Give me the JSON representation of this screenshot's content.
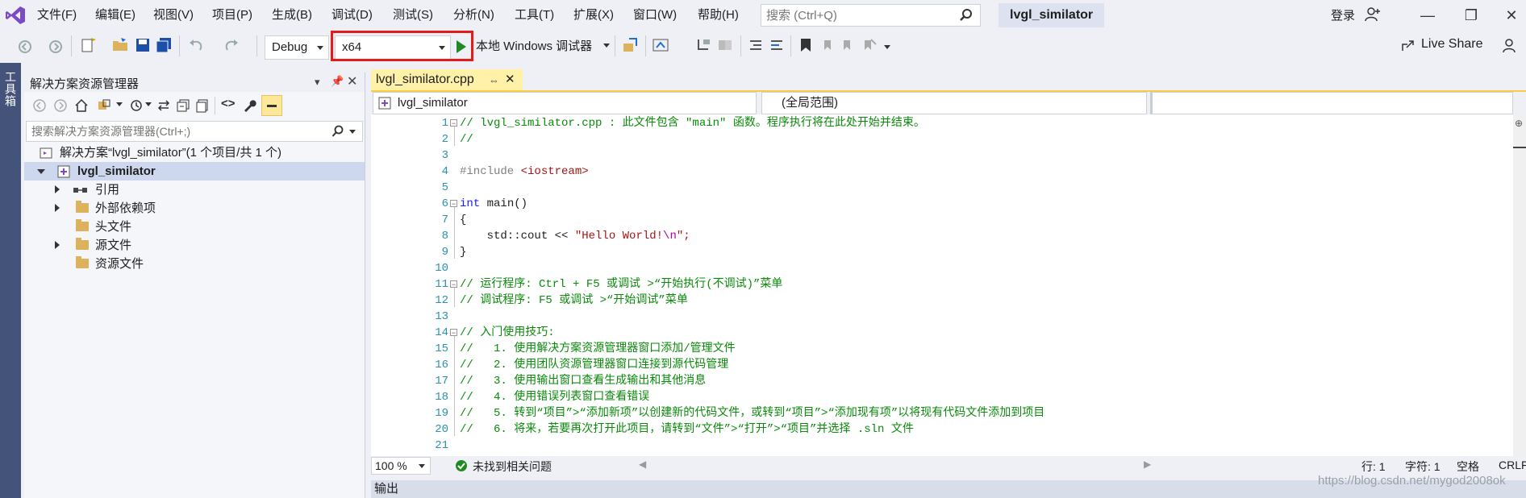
{
  "menubar": {
    "items": [
      "文件(F)",
      "编辑(E)",
      "视图(V)",
      "项目(P)",
      "生成(B)",
      "调试(D)",
      "测试(S)",
      "分析(N)",
      "工具(T)",
      "扩展(X)",
      "窗口(W)",
      "帮助(H)"
    ],
    "search_placeholder": "搜索 (Ctrl+Q)",
    "solution_name": "lvgl_similator",
    "login": "登录"
  },
  "toolbar": {
    "config": "Debug",
    "platform": "x64",
    "debugger": "本地 Windows 调试器",
    "live_share": "Live Share"
  },
  "leftstrip": {
    "toolbox": "工具箱"
  },
  "solution_explorer": {
    "title": "解决方案资源管理器",
    "search_placeholder": "搜索解决方案资源管理器(Ctrl+;)",
    "solution_label": "解决方案“lvgl_similator”(1 个项目/共 1 个)",
    "project": "lvgl_similator",
    "nodes": [
      "引用",
      "外部依赖项",
      "头文件",
      "源文件",
      "资源文件"
    ]
  },
  "editor": {
    "tab": "lvgl_similator.cpp",
    "nav_project": "lvgl_similator",
    "nav_scope": "(全局范围)",
    "lines": {
      "l1": "// lvgl_similator.cpp : 此文件包含 \"main\" 函数。程序执行将在此处开始并结束。",
      "l2": "//",
      "l4_pp": "#include ",
      "l4_inc": "<iostream>",
      "l6_kw": "int",
      "l6_rest": " main()",
      "l7": "{",
      "l8_a": "    std::cout << ",
      "l8_s": "\"Hello World!",
      "l8_e": "\\n",
      "l8_end": "\";",
      "l9": "}",
      "l11": "// 运行程序: Ctrl + F5 或调试 >“开始执行(不调试)”菜单",
      "l12": "// 调试程序: F5 或调试 >“开始调试”菜单",
      "l14": "// 入门使用技巧:",
      "l15": "//   1. 使用解决方案资源管理器窗口添加/管理文件",
      "l16": "//   2. 使用团队资源管理器窗口连接到源代码管理",
      "l17": "//   3. 使用输出窗口查看生成输出和其他消息",
      "l18": "//   4. 使用错误列表窗口查看错误",
      "l19": "//   5. 转到“项目”>“添加新项”以创建新的代码文件，或转到“项目”>“添加现有项”以将现有代码文件添加到项目",
      "l20": "//   6. 将来，若要再次打开此项目，请转到“文件”>“打开”>“项目”并选择 .sln 文件"
    },
    "line_numbers": [
      "1",
      "2",
      "3",
      "4",
      "5",
      "6",
      "7",
      "8",
      "9",
      "10",
      "11",
      "12",
      "13",
      "14",
      "15",
      "16",
      "17",
      "18",
      "19",
      "20",
      "21"
    ]
  },
  "status": {
    "zoom": "100 %",
    "issues": "未找到相关问题",
    "row": "行: 1",
    "col": "字符: 1",
    "spaces": "空格",
    "eol": "CRLF"
  },
  "output": {
    "title": "输出"
  },
  "watermark": "https://blog.csdn.net/mygod2008ok"
}
